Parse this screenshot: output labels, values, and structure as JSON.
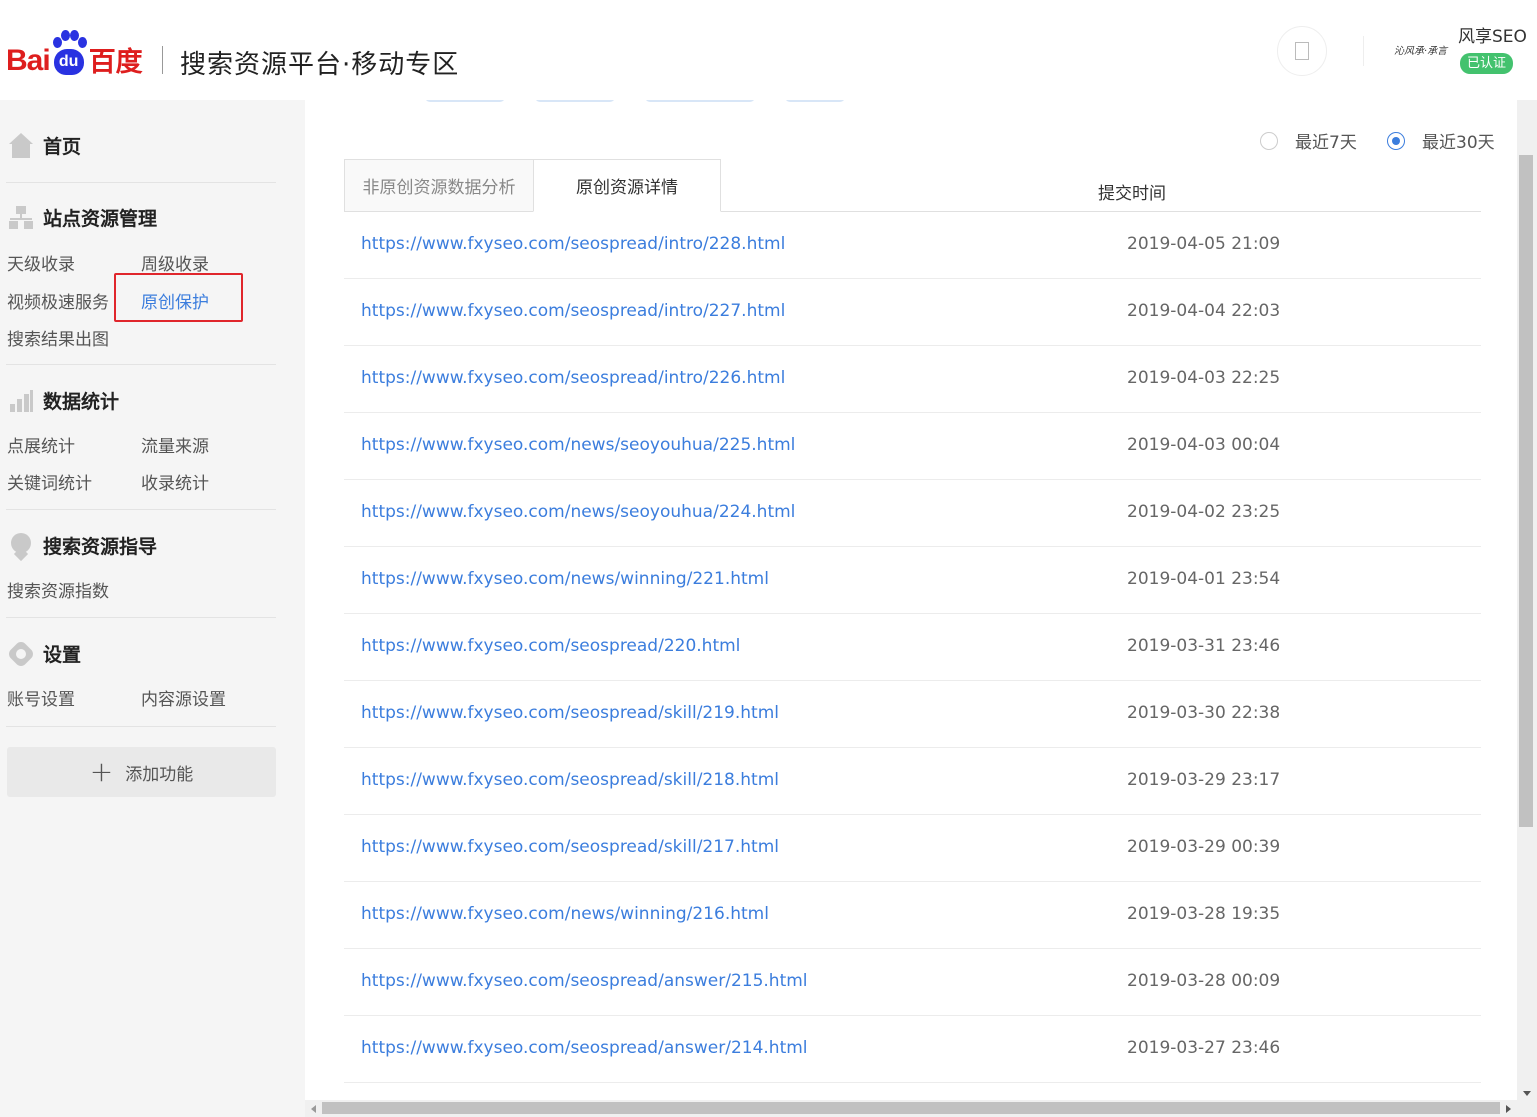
{
  "header": {
    "logo_latin": "Bai",
    "logo_paw_text": "du",
    "logo_cn": "百度",
    "platform_title": "搜索资源平台·移动专区",
    "signature": "沁风承·承言",
    "username": "风享SEO",
    "verified_badge": "已认证"
  },
  "sidebar": {
    "home": "首页",
    "site_mgmt": {
      "title": "站点资源管理",
      "items": [
        "天级收录",
        "周级收录",
        "视频极速服务",
        "原创保护",
        "搜索结果出图"
      ]
    },
    "stats": {
      "title": "数据统计",
      "items": [
        "点展统计",
        "流量来源",
        "关键词统计",
        "收录统计"
      ]
    },
    "guide": {
      "title": "搜索资源指导",
      "items": [
        "搜索资源指数"
      ]
    },
    "settings": {
      "title": "设置",
      "items": [
        "账号设置",
        "内容源设置"
      ]
    },
    "add_feature": "添加功能",
    "active_item": "原创保护"
  },
  "main": {
    "range_options": [
      "最近7天",
      "最近30天"
    ],
    "range_selected": "最近30天",
    "tabs": [
      "非原创资源数据分析",
      "原创资源详情"
    ],
    "active_tab": "原创资源详情",
    "col_submit_time": "提交时间",
    "rows": [
      {
        "url": "https://www.fxyseo.com/seospread/intro/228.html",
        "time": "2019-04-05 21:09"
      },
      {
        "url": "https://www.fxyseo.com/seospread/intro/227.html",
        "time": "2019-04-04 22:03"
      },
      {
        "url": "https://www.fxyseo.com/seospread/intro/226.html",
        "time": "2019-04-03 22:25"
      },
      {
        "url": "https://www.fxyseo.com/news/seoyouhua/225.html",
        "time": "2019-04-03 00:04"
      },
      {
        "url": "https://www.fxyseo.com/news/seoyouhua/224.html",
        "time": "2019-04-02 23:25"
      },
      {
        "url": "https://www.fxyseo.com/news/winning/221.html",
        "time": "2019-04-01 23:54"
      },
      {
        "url": "https://www.fxyseo.com/seospread/220.html",
        "time": "2019-03-31 23:46"
      },
      {
        "url": "https://www.fxyseo.com/seospread/skill/219.html",
        "time": "2019-03-30 22:38"
      },
      {
        "url": "https://www.fxyseo.com/seospread/skill/218.html",
        "time": "2019-03-29 23:17"
      },
      {
        "url": "https://www.fxyseo.com/seospread/skill/217.html",
        "time": "2019-03-29 00:39"
      },
      {
        "url": "https://www.fxyseo.com/news/winning/216.html",
        "time": "2019-03-28 19:35"
      },
      {
        "url": "https://www.fxyseo.com/seospread/answer/215.html",
        "time": "2019-03-28 00:09"
      },
      {
        "url": "https://www.fxyseo.com/seospread/answer/214.html",
        "time": "2019-03-27 23:46"
      }
    ]
  },
  "colors": {
    "link": "#3b7ddd",
    "brand_red": "#de1e1e",
    "brand_blue": "#2932e1",
    "verified_green": "#43c26e",
    "highlight_red": "#e0262c"
  }
}
